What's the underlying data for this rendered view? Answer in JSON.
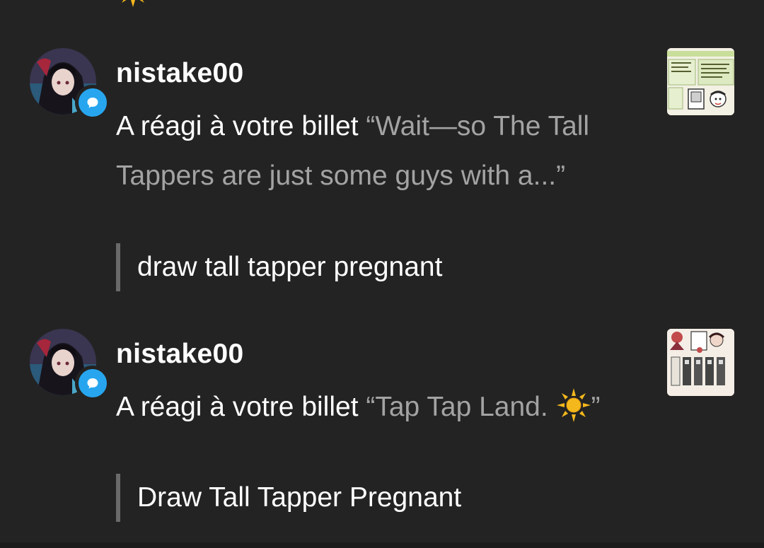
{
  "notifications": [
    {
      "username": "nistake00",
      "action": "A réagi à votre billet ",
      "quote": "“Wait—so The Tall Tappers are just some guys with a...”",
      "quote_has_sun": false,
      "reply": "draw tall tapper pregnant"
    },
    {
      "username": "nistake00",
      "action": "A réagi à votre billet ",
      "quote_prefix": "“Tap Tap Land. ",
      "quote_suffix": "”",
      "quote_has_sun": true,
      "reply": "Draw Tall Tapper Pregnant"
    }
  ],
  "icons": {
    "reply_badge": "speech-bubble-icon",
    "sun": "sun-emoji-icon"
  },
  "colors": {
    "background": "#232323",
    "quote_text": "#a3a3a3",
    "badge": "#27a6ef",
    "reply_bar": "#6a6a6a"
  }
}
